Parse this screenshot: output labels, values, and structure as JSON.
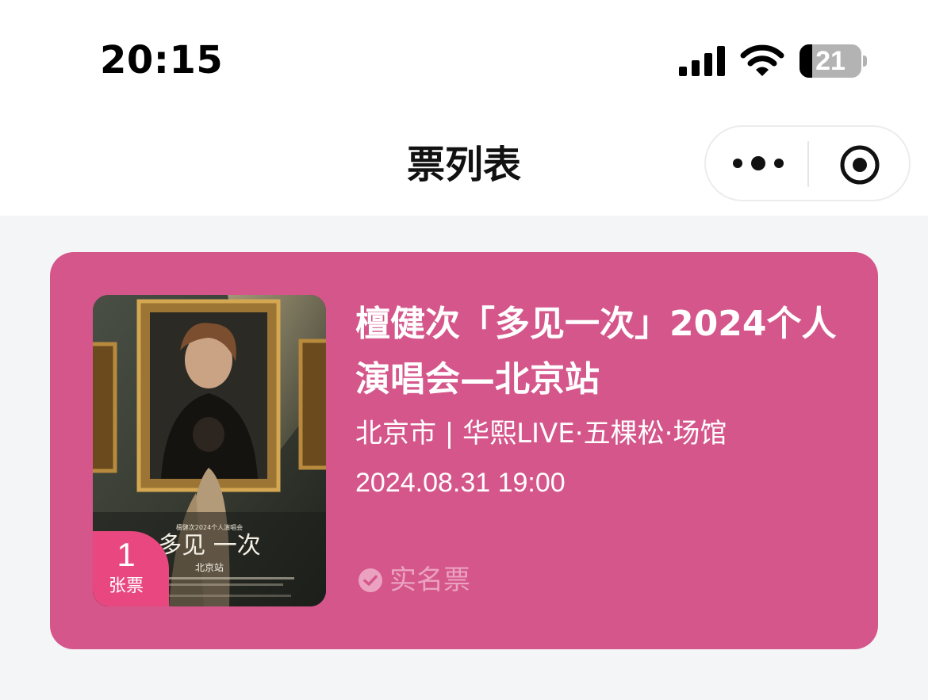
{
  "status_bar": {
    "time": "20:15",
    "battery_level": "21",
    "icons": [
      "signal-icon",
      "wifi-icon",
      "battery-icon"
    ]
  },
  "nav": {
    "title": "票列表",
    "capsule_icons": [
      "more-icon",
      "close-mini-program-icon"
    ]
  },
  "ticket": {
    "count": "1",
    "count_unit": "张票",
    "title": "檀健次「多见一次」2024个人演唱会—北京站",
    "venue": "北京市 | 华熙LIVE·五棵松·场馆",
    "datetime": "2024.08.31 19:00",
    "tag": "实名票",
    "card_color": "#d4568b",
    "badge_color": "#e8487f"
  }
}
